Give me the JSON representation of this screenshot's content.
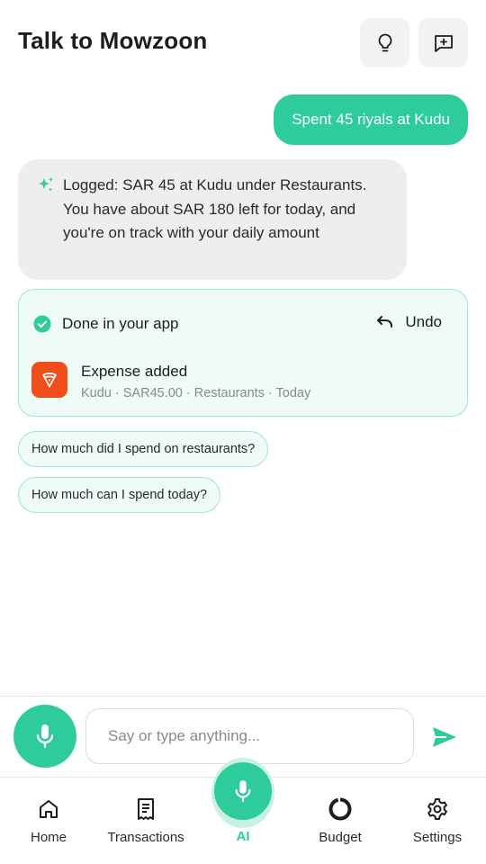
{
  "header": {
    "title": "Talk to Mowzoon",
    "tips_icon": "lightbulb-icon",
    "new_chat_icon": "new-chat-icon"
  },
  "conversation": {
    "user_message": "Spent 45 riyals at Kudu",
    "ai_message": "Logged: SAR 45 at Kudu under Restaurants. You have about SAR 180 left for today, and you're on track with your daily amount",
    "ai_icon": "sparkle-icon"
  },
  "action_card": {
    "status_label": "Done in your app",
    "undo_label": "Undo",
    "expense_title": "Expense added",
    "expense_meta": "Kudu · SAR45.00 · Restaurants · Today"
  },
  "suggestions": [
    "How much did I spend on restaurants?",
    "How much can I spend today?"
  ],
  "composer": {
    "placeholder": "Say or type anything..."
  },
  "nav": {
    "home": "Home",
    "transactions": "Transactions",
    "ai": "AI",
    "budget": "Budget",
    "settings": "Settings"
  },
  "colors": {
    "accent": "#2ecc9a",
    "accent_soft": "#eefbf6",
    "accent_border": "#9de6cb",
    "bubble_gray": "#eeeeee",
    "restaurant_icon": "#f04e1a"
  }
}
